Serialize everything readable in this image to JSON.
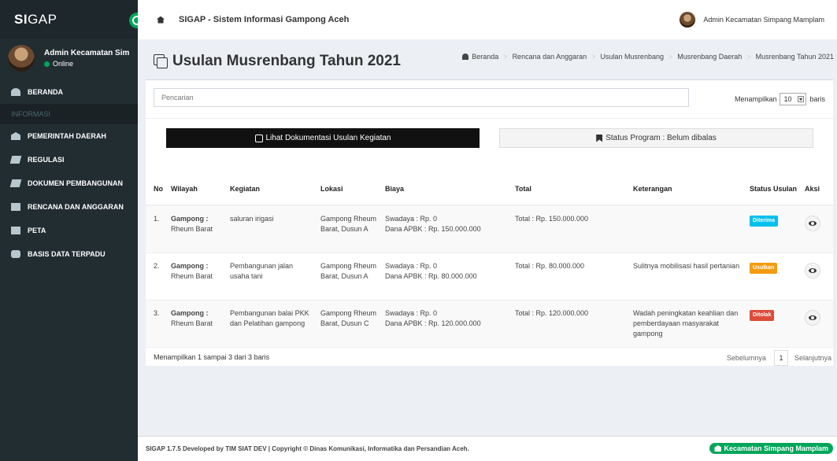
{
  "app": {
    "logo_bold": "SI",
    "logo_rest": "GAP",
    "title": "SIGAP - Sistem Informasi Gampong Aceh"
  },
  "user": {
    "name": "Admin Kecamatan Simpang Mamplam",
    "sidebar_name": "Admin Kecamatan Simpa",
    "status": "Online"
  },
  "sidebar": {
    "items": [
      {
        "label": "BERANDA",
        "icon": "dashboard-icon"
      },
      {
        "label": "INFORMASI",
        "header": true
      },
      {
        "label": "PEMERINTAH DAERAH",
        "icon": "bank-icon"
      },
      {
        "label": "REGULASI",
        "icon": "book-icon"
      },
      {
        "label": "DOKUMEN PEMBANGUNAN",
        "icon": "book-icon"
      },
      {
        "label": "RENCANA DAN ANGGARAN",
        "icon": "bookmark-icon"
      },
      {
        "label": "PETA",
        "icon": "map-icon"
      },
      {
        "label": "BASIS DATA TERPADU",
        "icon": "database-icon"
      }
    ]
  },
  "page": {
    "title": "Usulan Musrenbang Tahun 2021",
    "breadcrumb": [
      "Beranda",
      "Rencana dan Anggaran",
      "Usulan Musrenbang",
      "Musrenbang Daerah",
      "Musrenbang Tahun 2021"
    ]
  },
  "toolbar": {
    "search_placeholder": "Pencarian",
    "length_prefix": "Menampilkan",
    "length_value": "10",
    "length_suffix": "baris",
    "doc_button": "Lihat Dokumentasi Usulan Kegiatan",
    "status_program": "Status Program : Belum dibalas"
  },
  "table": {
    "headers": [
      "No",
      "Wilayah",
      "Kegiatan",
      "Lokasi",
      "Biaya",
      "Total",
      "Keterangan",
      "Status Usulan",
      "Aksi"
    ],
    "rows": [
      {
        "no": "1.",
        "wilayah_label": "Gampong :",
        "wilayah": "Rheum Barat",
        "kegiatan": "saluran irigasi",
        "lokasi": "Gampong Rheum Barat, Dusun A",
        "swadaya": "Swadaya : Rp. 0",
        "apbk": "Dana APBK : Rp. 150.000.000",
        "total": "Total : Rp. 150.000.000",
        "keterangan": "",
        "status": "Diterima",
        "status_color": "#00c0ef"
      },
      {
        "no": "2.",
        "wilayah_label": "Gampong :",
        "wilayah": "Rheum Barat",
        "kegiatan": "Pembangunan jalan usaha tani",
        "lokasi": "Gampong Rheum Barat, Dusun A",
        "swadaya": "Swadaya : Rp. 0",
        "apbk": "Dana APBK : Rp. 80.000.000",
        "total": "Total : Rp. 80.000.000",
        "keterangan": "Sulitnya mobilisasi hasil pertanian",
        "status": "Usulkan",
        "status_color": "#f39c12"
      },
      {
        "no": "3.",
        "wilayah_label": "Gampong :",
        "wilayah": "Rheum Barat",
        "kegiatan": "Pembangunan balai PKK dan Pelatihan gampong",
        "lokasi": "Gampong Rheum Barat, Dusun C",
        "swadaya": "Swadaya : Rp. 0",
        "apbk": "Dana APBK : Rp. 120.000.000",
        "total": "Total : Rp. 120.000.000",
        "keterangan": "Wadah peningkatan keahlian dan pemberdayaan masyarakat gampong",
        "status": "Ditolak",
        "status_color": "#dd4b39"
      }
    ],
    "info": "Menampilkan 1 sampai 3 dari 3 baris",
    "prev": "Sebelumnya",
    "page": "1",
    "next": "Selanjutnya"
  },
  "footer": {
    "text": "SIGAP 1.7.5 Developed by TIM SIAT DEV | Copyright © Dinas Komunikasi, Informatika dan Persandian Aceh.",
    "badge": "Kecamatan Simpang Mamplam"
  }
}
